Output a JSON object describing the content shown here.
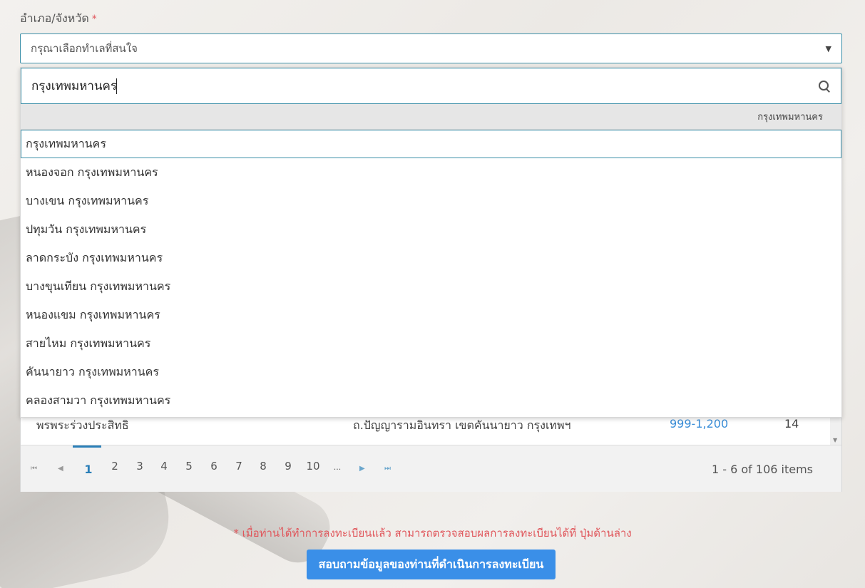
{
  "field": {
    "label": "อำเภอ/จังหวัด",
    "required_mark": "*",
    "selected_value": "กรุณาเลือกทำเลที่สนใจ"
  },
  "dropdown": {
    "search_value": "กรุงเทพมหานคร",
    "group_header": "กรุงเทพมหานคร",
    "options": [
      "กรุงเทพมหานคร",
      "หนองจอก กรุงเทพมหานคร",
      "บางเขน กรุงเทพมหานคร",
      "ปทุมวัน กรุงเทพมหานคร",
      "ลาดกระบัง กรุงเทพมหานคร",
      "บางขุนเทียน กรุงเทพมหานคร",
      "หนองแขม กรุงเทพมหานคร",
      "สายไหม กรุงเทพมหานคร",
      "คันนายาว กรุงเทพมหานคร",
      "คลองสามวา กรุงเทพมหานคร"
    ]
  },
  "grid": {
    "row": {
      "name": "พรพระร่วงประสิทธิ",
      "address": "ถ.ปัญญารามอินทรา เขตคันนายาว กรุงเทพฯ",
      "price": "999-1,200",
      "count": "14"
    },
    "pager": {
      "pages": [
        "1",
        "2",
        "3",
        "4",
        "5",
        "6",
        "7",
        "8",
        "9",
        "10",
        "..."
      ],
      "current": "1",
      "info": "1 - 6 of 106 items"
    }
  },
  "note": "* เมื่อท่านได้ทำการลงทะเบียนแล้ว สามารถตรวจสอบผลการลงทะเบียนได้ที่ ปุ่มด้านล่าง",
  "submit_label": "สอบถามข้อมูลของท่านที่ดำเนินการลงทะเบียน",
  "colors": {
    "accent": "#3b8fa8",
    "button": "#3a8fe8",
    "required": "#e0565b",
    "price": "#3a8ed8"
  }
}
